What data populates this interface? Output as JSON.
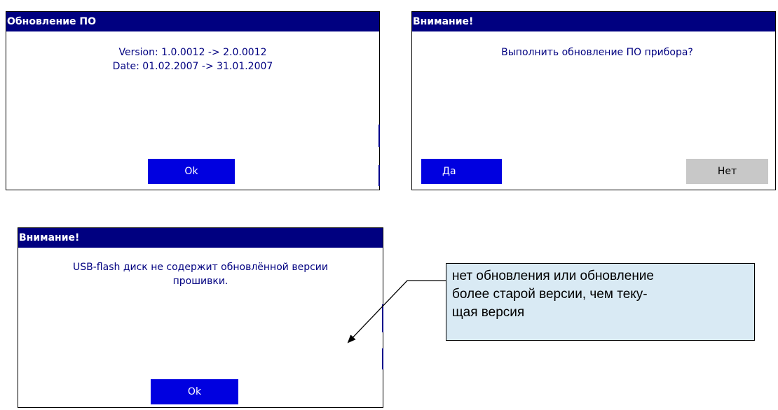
{
  "dialog_update": {
    "title": "Обновление ПО",
    "version_line": "Version: 1.0.0012 -> 2.0.0012",
    "date_line": "Date: 01.02.2007 -> 31.01.2007",
    "ok_label": "Ok"
  },
  "dialog_confirm": {
    "title": "Внимание!",
    "message": "Выполнить обновление ПО прибора?",
    "yes_label": "Да",
    "no_label": "Нет"
  },
  "dialog_no_update": {
    "title": "Внимание!",
    "message_line1": "USB-flash диск не содержит обновлённой версии",
    "message_line2": "прошивки.",
    "ok_label": "Ok"
  },
  "callout": {
    "line1": "нет обновления или обновление",
    "line2": "более старой версии, чем теку-",
    "line3": "щая версия"
  },
  "colors": {
    "titlebar": "#000080",
    "button_primary": "#0000e0",
    "button_secondary": "#c8c8c8",
    "text": "#000080",
    "callout_bg": "#d9eaf4"
  }
}
